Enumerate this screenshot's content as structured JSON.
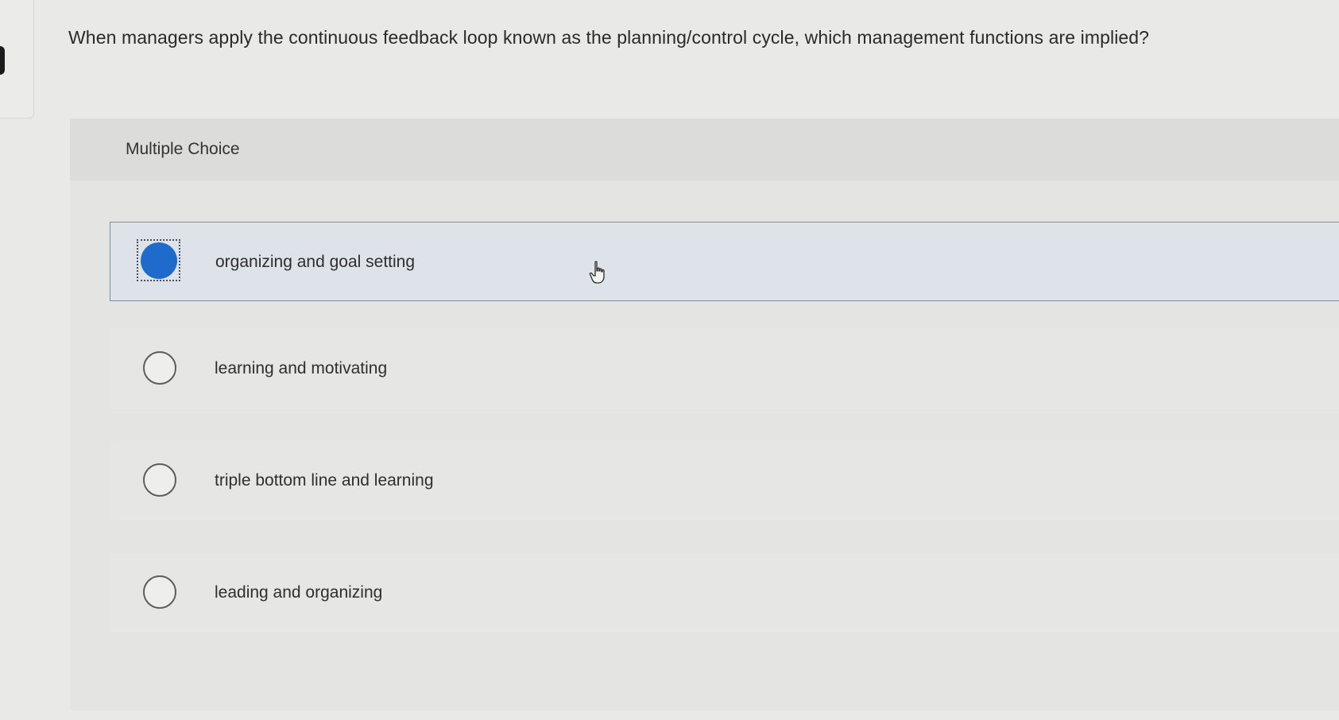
{
  "question": {
    "text": "When managers apply the continuous feedback loop known as the planning/control cycle, which management functions are implied?"
  },
  "panel": {
    "label": "Multiple Choice"
  },
  "options": [
    {
      "label": "organizing and goal setting",
      "selected": true
    },
    {
      "label": "learning and motivating",
      "selected": false
    },
    {
      "label": "triple bottom line and learning",
      "selected": false
    },
    {
      "label": "leading and organizing",
      "selected": false
    }
  ],
  "colors": {
    "selected_radio": "#1e6bcc",
    "selected_row_bg": "#dde3e8"
  },
  "icons": {
    "cursor": "hand-pointer-icon"
  }
}
